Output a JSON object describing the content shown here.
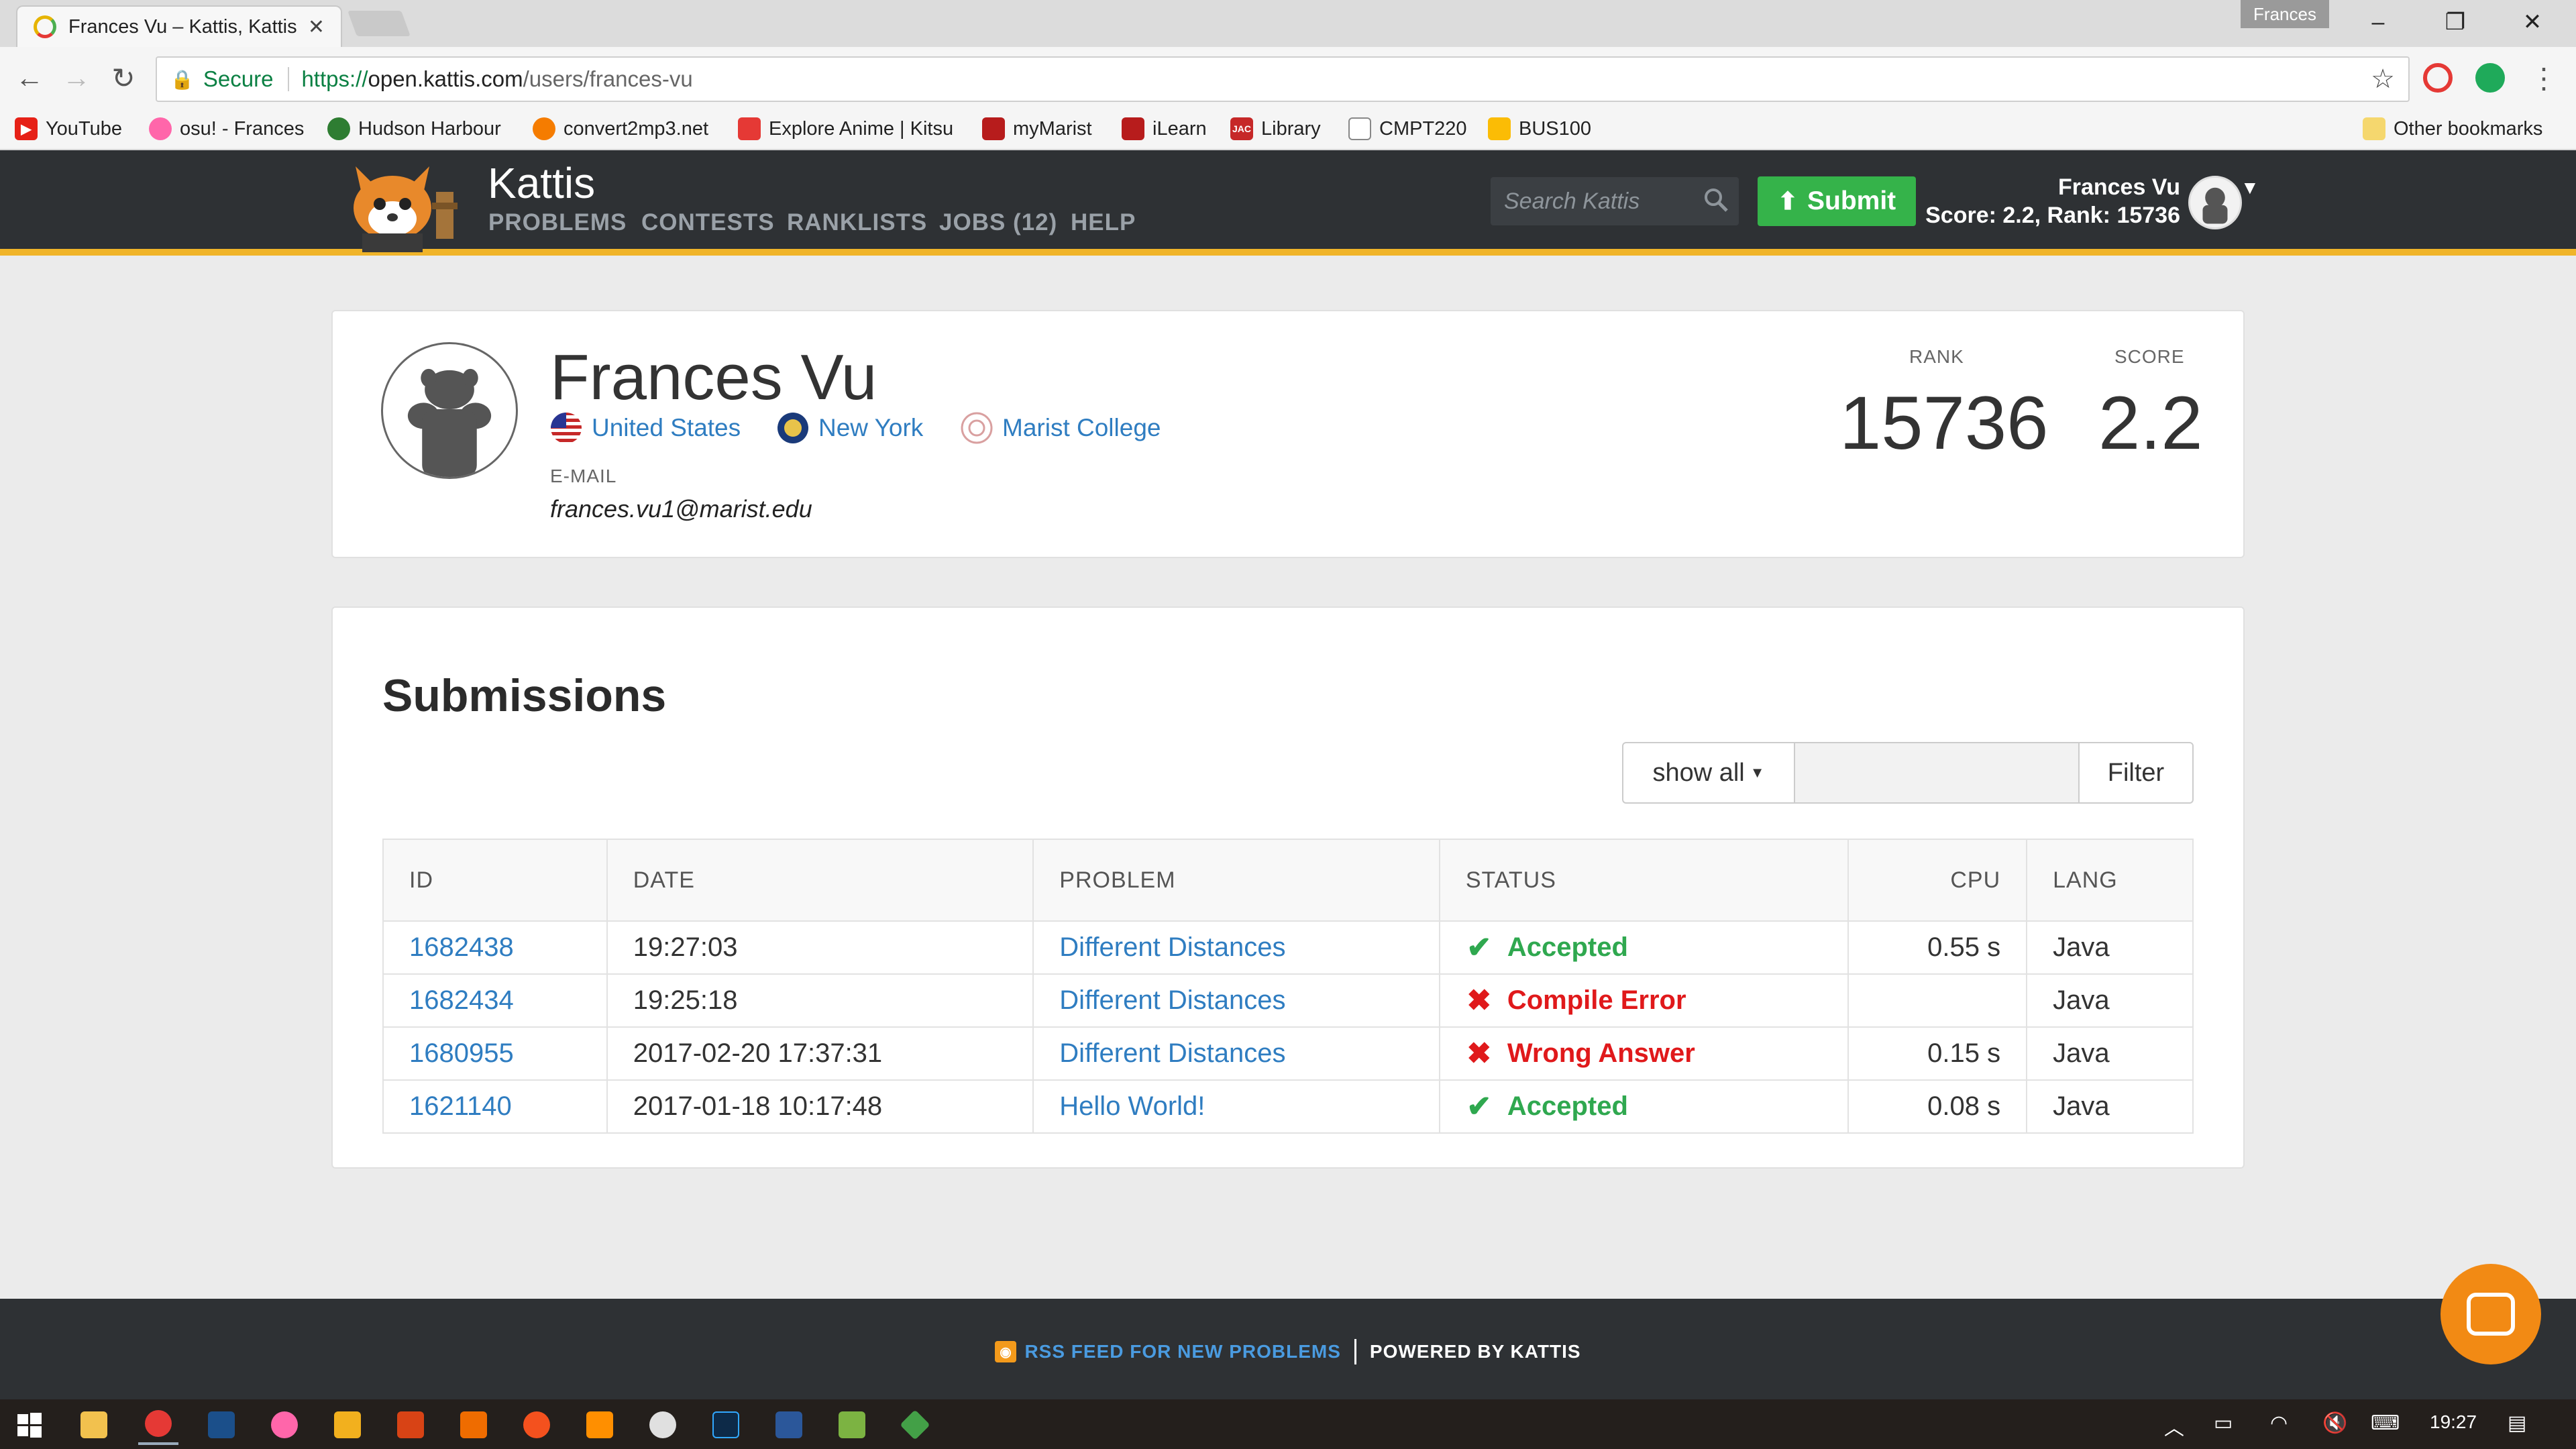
{
  "browser": {
    "tab_title": "Frances Vu – Kattis, Kattis",
    "profile_name": "Frances",
    "secure_label": "Secure",
    "url_scheme": "https://",
    "url_host": "open.kattis.com",
    "url_path": "/users/frances-vu",
    "bookmarks": [
      {
        "label": "YouTube",
        "icon": "youtube-icon",
        "color": "#e62117"
      },
      {
        "label": "osu! - Frances",
        "icon": "osu-icon",
        "color": "#ff66aa"
      },
      {
        "label": "Hudson Harbour",
        "icon": "chrome-icon",
        "color": "#2e7d32"
      },
      {
        "label": "convert2mp3.net",
        "icon": "convert-icon",
        "color": "#f57c00"
      },
      {
        "label": "Explore Anime | Kitsu",
        "icon": "kitsu-icon",
        "color": "#e53935"
      },
      {
        "label": "myMarist",
        "icon": "marist-fox-icon",
        "color": "#b71c1c"
      },
      {
        "label": "iLearn",
        "icon": "ilearn-fox-icon",
        "color": "#b71c1c"
      },
      {
        "label": "Library",
        "icon": "jac-icon",
        "color": "#c62828"
      },
      {
        "label": "CMPT220",
        "icon": "page-icon",
        "color": "#ffffff"
      },
      {
        "label": "BUS100",
        "icon": "drive-icon",
        "color": "#fbbc05"
      }
    ],
    "other_bookmarks": "Other bookmarks"
  },
  "header": {
    "brand": "Kattis",
    "nav": [
      "PROBLEMS",
      "CONTESTS",
      "RANKLISTS",
      "JOBS (12)",
      "HELP"
    ],
    "search_placeholder": "Search Kattis",
    "submit_label": "Submit",
    "user_name": "Frances Vu",
    "user_score": "Score: 2.2, Rank: 15736"
  },
  "profile": {
    "name": "Frances Vu",
    "country": "United States",
    "region": "New York",
    "school": "Marist College",
    "email_label": "E-MAIL",
    "email": "frances.vu1@marist.edu",
    "rank_label": "RANK",
    "rank": "15736",
    "score_label": "SCORE",
    "score": "2.2"
  },
  "submissions": {
    "title": "Submissions",
    "filter_select": "show all",
    "filter_button": "Filter",
    "columns": [
      "ID",
      "DATE",
      "PROBLEM",
      "STATUS",
      "CPU",
      "LANG"
    ],
    "rows": [
      {
        "id": "1682438",
        "date": "19:27:03",
        "problem": "Different Distances",
        "status": "Accepted",
        "ok": true,
        "cpu": "0.55 s",
        "lang": "Java"
      },
      {
        "id": "1682434",
        "date": "19:25:18",
        "problem": "Different Distances",
        "status": "Compile Error",
        "ok": false,
        "cpu": "",
        "lang": "Java"
      },
      {
        "id": "1680955",
        "date": "2017-02-20 17:37:31",
        "problem": "Different Distances",
        "status": "Wrong Answer",
        "ok": false,
        "cpu": "0.15 s",
        "lang": "Java"
      },
      {
        "id": "1621140",
        "date": "2017-01-18 10:17:48",
        "problem": "Hello World!",
        "status": "Accepted",
        "ok": true,
        "cpu": "0.08 s",
        "lang": "Java"
      }
    ]
  },
  "footer": {
    "rss_label": "RSS FEED FOR NEW PROBLEMS",
    "powered_label": "POWERED BY KATTIS"
  },
  "taskbar": {
    "time": "19:27"
  },
  "colors": {
    "header_bg": "#2e3134",
    "accent_stripe": "#f0b429",
    "submit_green": "#35b34a",
    "link_blue": "#2f7dc1",
    "accepted": "#2fa84f",
    "error": "#e0191b"
  }
}
